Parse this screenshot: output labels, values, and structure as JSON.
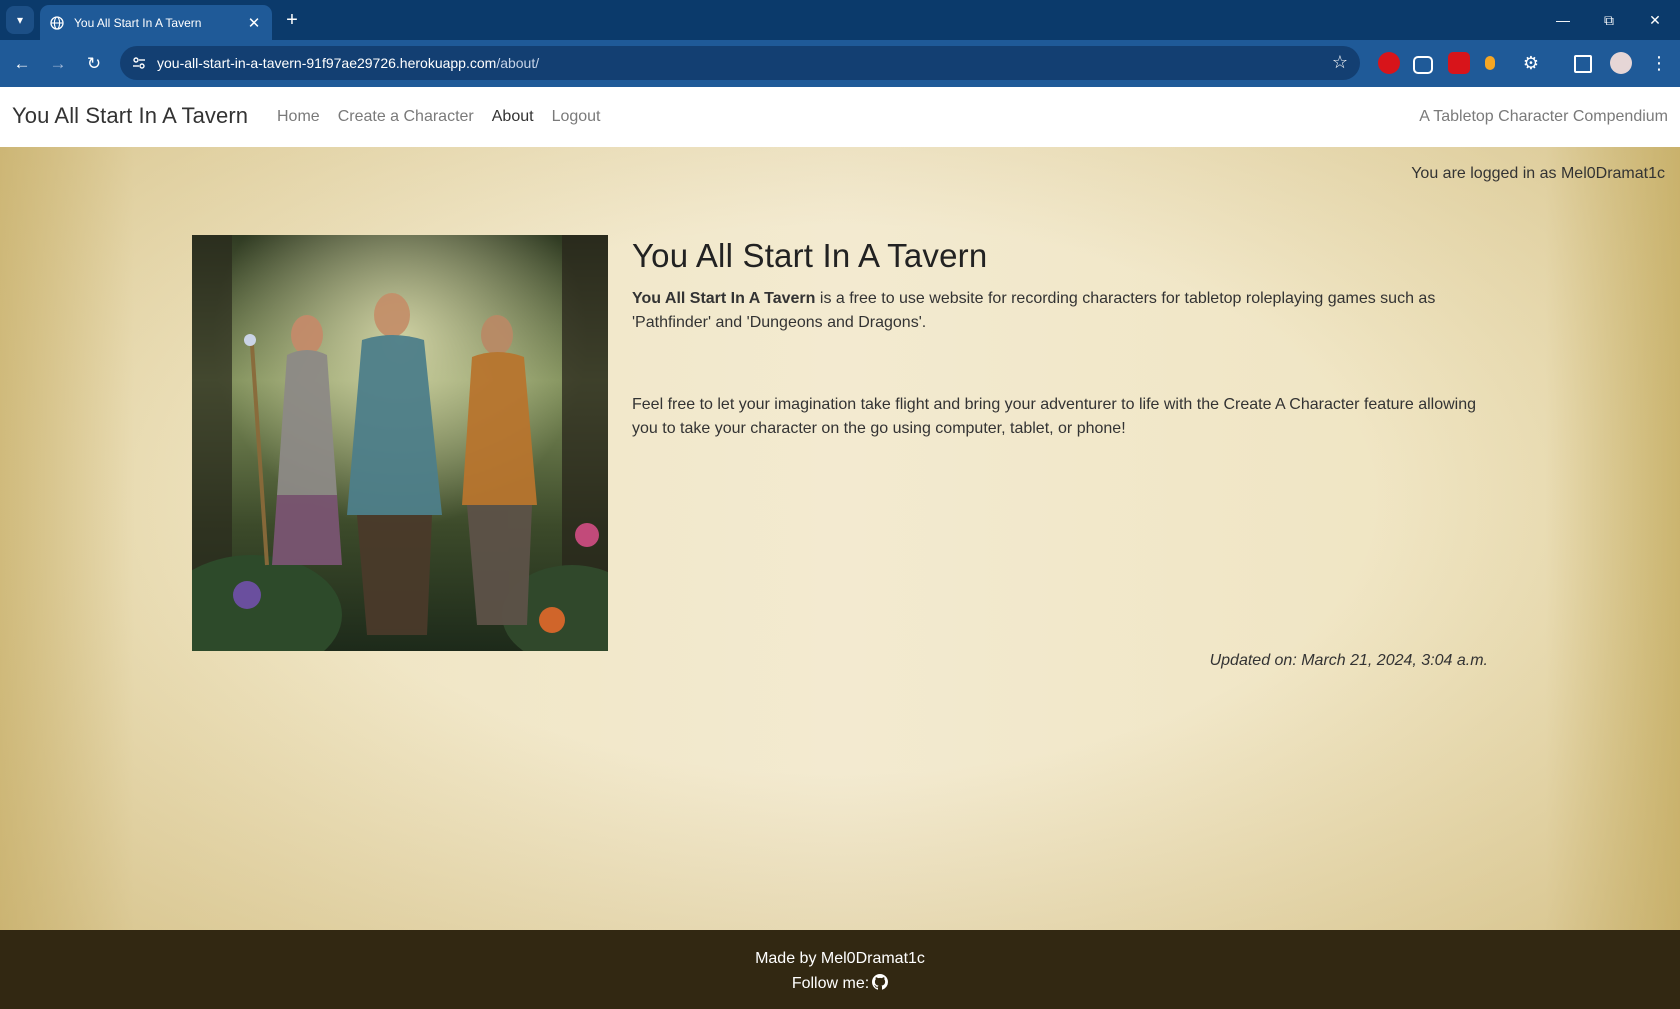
{
  "browser": {
    "tab_title": "You All Start In A Tavern",
    "url_domain": "you-all-start-in-a-tavern-91f97ae29726.herokuapp.com",
    "url_path": "/about/",
    "icons": [
      "tab-search-icon",
      "globe-icon",
      "close-icon",
      "plus-icon",
      "minimize-icon",
      "restore-icon",
      "window-close-icon",
      "back-icon",
      "forward-icon",
      "reload-icon",
      "site-settings-icon",
      "star-icon",
      "extensions-icon",
      "side-panel-icon",
      "profile-icon",
      "menu-icon"
    ]
  },
  "navbar": {
    "brand": "You All Start In A Tavern",
    "links": [
      {
        "label": "Home"
      },
      {
        "label": "Create a Character"
      },
      {
        "label": "About"
      },
      {
        "label": "Logout"
      }
    ],
    "active_link": "About",
    "tagline": "A Tabletop Character Compendium"
  },
  "main": {
    "login_status": "You are logged in as Mel0Dramat1c",
    "heading": "You All Start In A Tavern",
    "intro_bold": "You All Start In A Tavern",
    "intro_rest": " is a free to use website for recording characters for tabletop roleplaying games such as 'Pathfinder' and 'Dungeons and Dragons'.",
    "second_paragraph": "Feel free to let your imagination take flight and bring your adventurer to life with the Create A Character feature allowing you to take your character on the go using computer, tablet, or phone!",
    "updated": "Updated on: March 21, 2024, 3:04 a.m."
  },
  "footer": {
    "made_by": "Made by Mel0Dramat1c",
    "follow": "Follow me:"
  },
  "colors": {
    "chrome_dark": "#0b3a6b",
    "chrome_toolbar": "#1f5a98",
    "footer_bg": "#322812",
    "parchment": "#f3ead0"
  }
}
